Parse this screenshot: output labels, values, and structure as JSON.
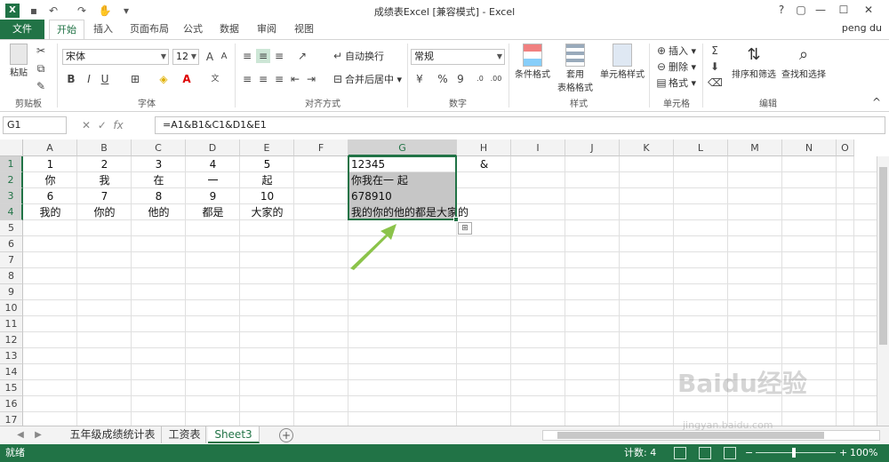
{
  "window": {
    "title": "成绩表Excel [兼容模式] - Excel",
    "controls": [
      "?",
      "▢",
      "—",
      "☐",
      "✕"
    ]
  },
  "ribbon_tabs": {
    "file": "文件",
    "items": [
      "开始",
      "插入",
      "页面布局",
      "公式",
      "数据",
      "审阅",
      "视图"
    ],
    "user": "peng du"
  },
  "ribbon": {
    "clipboard": {
      "paste": "粘贴",
      "label": "剪贴板"
    },
    "font": {
      "name": "宋体",
      "size": "12",
      "bold": "B",
      "italic": "I",
      "underline": "U",
      "label": "字体"
    },
    "alignment": {
      "wrap": "自动换行",
      "merge": "合并后居中",
      "label": "对齐方式"
    },
    "number": {
      "format": "常规",
      "percent": "%",
      "comma": "9",
      "label": "数字"
    },
    "styles": {
      "conditional": "条件格式",
      "table1": "套用",
      "table2": "表格格式",
      "cell": "单元格样式",
      "label": "样式"
    },
    "cells": {
      "insert": "插入",
      "delete": "删除",
      "format": "格式",
      "label": "单元格"
    },
    "editing": {
      "sort": "排序和筛选",
      "find": "查找和选择",
      "label": "编辑"
    }
  },
  "formula_bar": {
    "name_box": "G1",
    "fx": "fx",
    "formula": "=A1&B1&C1&D1&E1"
  },
  "columns": [
    "A",
    "B",
    "C",
    "D",
    "E",
    "F",
    "G",
    "H",
    "I",
    "J",
    "K",
    "L",
    "M",
    "N",
    "O"
  ],
  "rows": [
    "1",
    "2",
    "3",
    "4",
    "5",
    "6",
    "7",
    "8",
    "9",
    "10",
    "11",
    "12",
    "13",
    "14",
    "15",
    "16",
    "17"
  ],
  "cells": {
    "r1": [
      "1",
      "2",
      "3",
      "4",
      "5"
    ],
    "r2": [
      "你",
      "我",
      "在",
      "一",
      "起"
    ],
    "r3": [
      "6",
      "7",
      "8",
      "9",
      "10"
    ],
    "r4": [
      "我的",
      "你的",
      "他的",
      "都是",
      "大家的"
    ],
    "g1": "12345",
    "g2": "你我在一 起",
    "g3": "678910",
    "g4": "我的你的他的都是大家的",
    "h1": "&"
  },
  "sheets": [
    "五年级成绩统计表",
    "工资表",
    "Sheet3"
  ],
  "active_sheet": "Sheet3",
  "status": {
    "ready": "就绪",
    "count": "计数: 4",
    "zoom": "100%"
  },
  "watermark": {
    "brand": "Baidu经验",
    "url": "jingyan.baidu.com"
  },
  "colors": {
    "excel_green": "#217346",
    "selection_fill": "#c6c6c6",
    "arrow": "#8bc34a"
  }
}
